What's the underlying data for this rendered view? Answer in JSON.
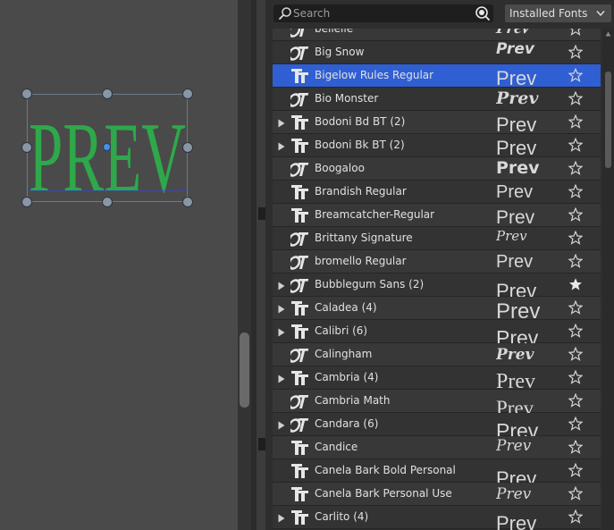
{
  "canvas": {
    "art_text": "PREV",
    "art_color": "#2ea84a"
  },
  "search": {
    "value": "",
    "placeholder": "Search"
  },
  "font_source": {
    "selected": "Installed Fonts"
  },
  "font_list": {
    "rows": [
      {
        "name": "bellelle",
        "icon": "opentype-icon",
        "expandable": false,
        "preview": "Prev",
        "favorite": false,
        "selected": false
      },
      {
        "name": "Big Snow",
        "icon": "opentype-icon",
        "expandable": false,
        "preview": "Prev",
        "favorite": false,
        "selected": false
      },
      {
        "name": "Bigelow Rules Regular",
        "icon": "truetype-icon",
        "expandable": false,
        "preview": "Prev",
        "favorite": false,
        "selected": true
      },
      {
        "name": "Bio Monster",
        "icon": "opentype-icon",
        "expandable": false,
        "preview": "Prev",
        "favorite": false,
        "selected": false
      },
      {
        "name": "Bodoni Bd BT (2)",
        "icon": "truetype-icon",
        "expandable": true,
        "preview": "Prev",
        "favorite": false,
        "selected": false
      },
      {
        "name": "Bodoni Bk BT (2)",
        "icon": "truetype-icon",
        "expandable": true,
        "preview": "Prev",
        "favorite": false,
        "selected": false
      },
      {
        "name": "Boogaloo",
        "icon": "opentype-icon",
        "expandable": false,
        "preview": "Prev",
        "favorite": false,
        "selected": false
      },
      {
        "name": "Brandish Regular",
        "icon": "truetype-icon",
        "expandable": false,
        "preview": "Prev",
        "favorite": false,
        "selected": false
      },
      {
        "name": "Breamcatcher-Regular",
        "icon": "truetype-icon",
        "expandable": false,
        "preview": "Prev",
        "favorite": false,
        "selected": false
      },
      {
        "name": "Brittany Signature",
        "icon": "opentype-icon",
        "expandable": false,
        "preview": "Prev",
        "favorite": false,
        "selected": false
      },
      {
        "name": "bromello Regular",
        "icon": "opentype-icon",
        "expandable": false,
        "preview": "Prev",
        "favorite": false,
        "selected": false
      },
      {
        "name": "Bubblegum Sans (2)",
        "icon": "opentype-icon",
        "expandable": true,
        "preview": "Prev",
        "favorite": true,
        "selected": false
      },
      {
        "name": "Caladea (4)",
        "icon": "truetype-icon",
        "expandable": true,
        "preview": "Prev",
        "favorite": false,
        "selected": false
      },
      {
        "name": "Calibri (6)",
        "icon": "truetype-icon",
        "expandable": true,
        "preview": "Prev",
        "favorite": false,
        "selected": false
      },
      {
        "name": "Calingham",
        "icon": "opentype-icon",
        "expandable": false,
        "preview": "Prev",
        "favorite": false,
        "selected": false
      },
      {
        "name": "Cambria (4)",
        "icon": "truetype-icon",
        "expandable": true,
        "preview": "Prev",
        "favorite": false,
        "selected": false
      },
      {
        "name": "Cambria Math",
        "icon": "opentype-icon",
        "expandable": false,
        "preview": "Prev",
        "favorite": false,
        "selected": false
      },
      {
        "name": "Candara (6)",
        "icon": "opentype-icon",
        "expandable": true,
        "preview": "Prev",
        "favorite": false,
        "selected": false
      },
      {
        "name": "Candice",
        "icon": "truetype-icon",
        "expandable": false,
        "preview": "Prev",
        "favorite": false,
        "selected": false
      },
      {
        "name": "Canela Bark Bold Personal Use",
        "icon": "truetype-icon",
        "expandable": false,
        "preview": "Prev",
        "favorite": false,
        "selected": false
      },
      {
        "name": "Canela Bark Personal Use",
        "icon": "truetype-icon",
        "expandable": false,
        "preview": "Prev",
        "favorite": false,
        "selected": false
      },
      {
        "name": "Carlito (4)",
        "icon": "truetype-icon",
        "expandable": true,
        "preview": "Prev",
        "favorite": false,
        "selected": false
      }
    ]
  },
  "colors": {
    "selection": "#2f5fd3",
    "accent_handle": "#4a90e2"
  }
}
